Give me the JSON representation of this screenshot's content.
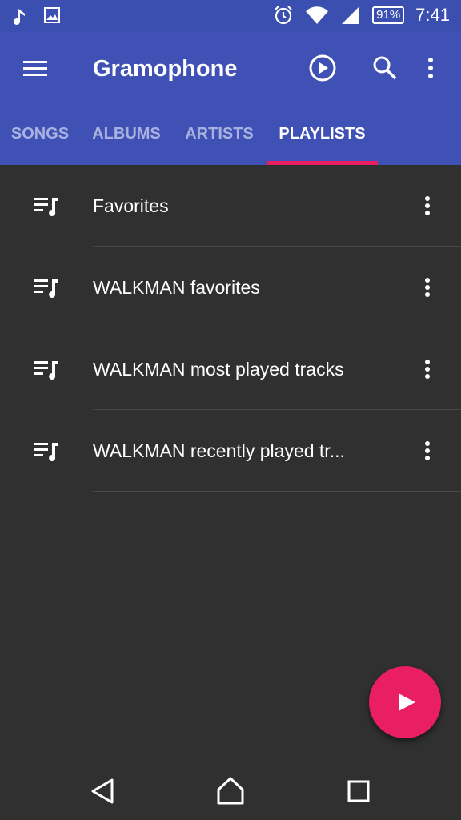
{
  "status_bar": {
    "time": "7:41",
    "battery": "91%",
    "icons": [
      "music-note-icon",
      "image-icon",
      "alarm-icon",
      "wifi-icon",
      "signal-icon",
      "battery-icon"
    ]
  },
  "app_bar": {
    "title": "Gramophone",
    "actions": [
      "menu-icon",
      "play-circle-icon",
      "search-icon",
      "more-vert-icon"
    ]
  },
  "tabs": [
    {
      "label": "SONGS",
      "active": false
    },
    {
      "label": "ALBUMS",
      "active": false
    },
    {
      "label": "ARTISTS",
      "active": false
    },
    {
      "label": "PLAYLISTS",
      "active": true
    }
  ],
  "playlists": [
    {
      "name": "Favorites"
    },
    {
      "name": "WALKMAN favorites"
    },
    {
      "name": "WALKMAN most played tracks"
    },
    {
      "name": "WALKMAN recently played tr..."
    }
  ],
  "fab": {
    "icon": "play-icon"
  },
  "nav_bar": {
    "buttons": [
      "back-icon",
      "home-icon",
      "recents-icon"
    ]
  },
  "colors": {
    "primary": "#3f51b5",
    "status_bar": "#3b4fb0",
    "accent": "#e91e63",
    "background": "#303030",
    "inactive_tab": "#a8b1e0"
  }
}
